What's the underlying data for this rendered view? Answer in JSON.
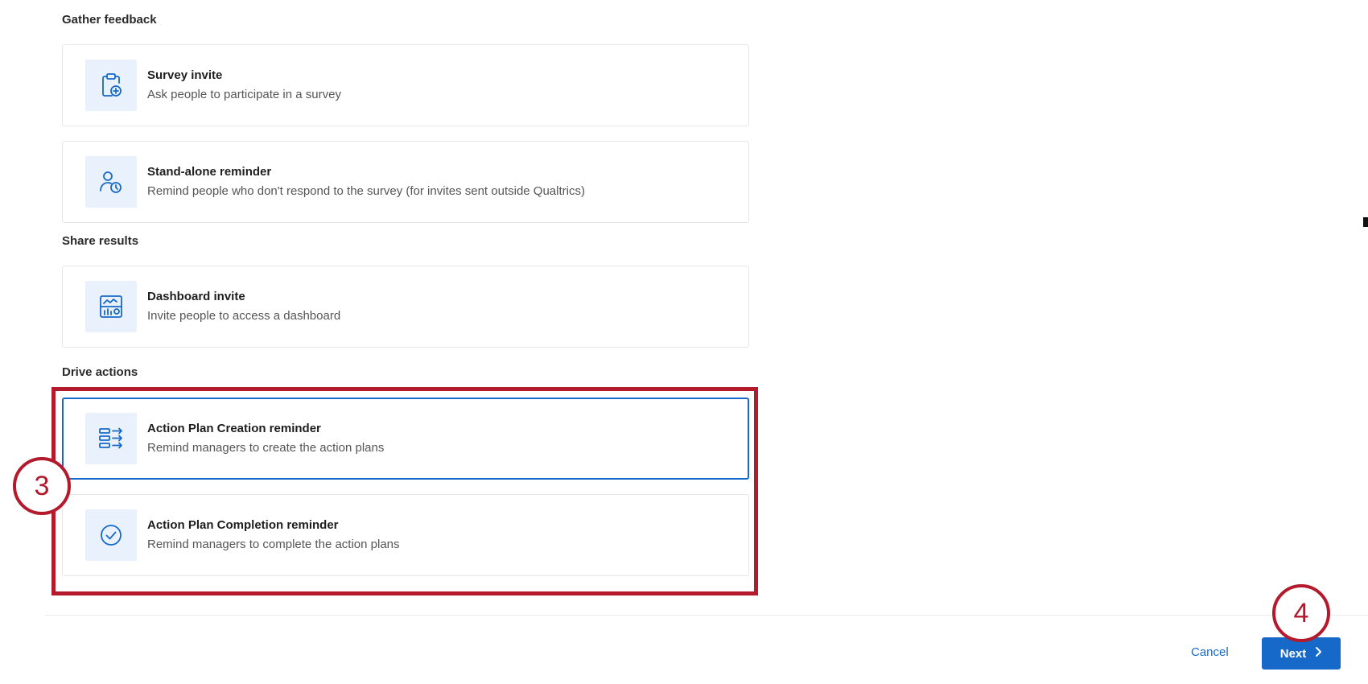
{
  "sections": {
    "gather_feedback": "Gather feedback",
    "share_results": "Share results",
    "drive_actions": "Drive actions"
  },
  "cards": {
    "survey_invite": {
      "title": "Survey invite",
      "description": "Ask people to participate in a survey",
      "icon": "clipboard-plus-icon"
    },
    "standalone_reminder": {
      "title": "Stand-alone reminder",
      "description": "Remind people who don't respond to the survey (for invites sent outside Qualtrics)",
      "icon": "person-clock-icon"
    },
    "dashboard_invite": {
      "title": "Dashboard invite",
      "description": "Invite people to access a dashboard",
      "icon": "dashboard-icon"
    },
    "action_plan_creation": {
      "title": "Action Plan Creation reminder",
      "description": "Remind managers to create the action plans",
      "icon": "list-arrows-icon",
      "selected": true
    },
    "action_plan_completion": {
      "title": "Action Plan Completion reminder",
      "description": "Remind managers to complete the action plans",
      "icon": "check-circle-icon"
    }
  },
  "annotations": {
    "step_3": "3",
    "step_4": "4"
  },
  "footer": {
    "cancel_label": "Cancel",
    "next_label": "Next"
  },
  "colors": {
    "accent": "#1769c9",
    "icon_bg": "#e9f2fc",
    "annotation_red": "#b31b2c"
  }
}
